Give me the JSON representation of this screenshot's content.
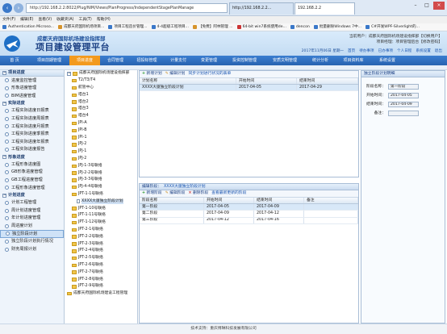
{
  "browser": {
    "url": "http://192.168.2.2:8022/Plug/NIM/Views/PlanProgress/IndependentStagePlanManage",
    "tabs": [
      "http://192.168.2.2...",
      "192.168.2.2"
    ],
    "menu": [
      "文件(F)",
      "编辑(E)",
      "查看(V)",
      "收藏夹(A)",
      "工具(T)",
      "帮助(H)"
    ],
    "favorites": [
      "Authentication Microso...",
      "成都天府国际机场项目...",
      "项目工程造价管理...",
      "4-4超级工程项目...",
      "【免费】阿林管理 ...",
      "64-bit win7系统使用de...",
      "dencon",
      "批量删除Windows 7中...",
      "C#开发WPF-Silverlight的..."
    ]
  },
  "header": {
    "system_name": "成都天府国际机场建设指挥部",
    "title": "项目建设管理平台",
    "user_line": "当前用户：成都天府国际机场建设指挥部【切换用户】",
    "user_line2": "项目经理：项目管理后台【修改密码】",
    "date": "2017年11月06日 星期一",
    "shortcuts": [
      "首页",
      "待办事项",
      "已办事项",
      "个人日程",
      "系统设置",
      "退出"
    ]
  },
  "nav": {
    "items": [
      "首 页",
      "项目前期管理",
      "项目进度",
      "合同管理",
      "招投标管理",
      "计量支付",
      "变更管理",
      "投资控制管理",
      "安质文明管理",
      "统计分析",
      "项目资料库",
      "系统设置"
    ],
    "active_index": 2
  },
  "sidebar": {
    "header": "项目进度",
    "groups": [
      {
        "label": "",
        "items": [
          "进度监控管理",
          "形象进度管理",
          "BIM进度管理"
        ]
      },
      {
        "label": "实际进度",
        "items": [
          "工程实际进度日报表",
          "工程实际进度周报表",
          "工程实际进度月报表",
          "工程实际进度季报表",
          "工程实际进度年报表",
          "工程实际进度报告"
        ]
      },
      {
        "label": "形象进度",
        "items": [
          "工程形象进度图",
          "GB形象进度管理",
          "GB工程进度管理",
          "工程形象进度管理"
        ]
      },
      {
        "label": "计划进度",
        "items": [
          "计划工程管理",
          "周计划进度管理",
          "年计划进度管理",
          "周进度计划"
        ]
      },
      {
        "label": "",
        "items": [
          "独立阶段计划",
          "独立阶段计划执行情况",
          "财务周报计划"
        ]
      }
    ],
    "active_item": "独立阶段计划"
  },
  "tree": {
    "root": "成都天府国际机场建设指挥部",
    "nodes": [
      "T2/T3/T4",
      "航管中心",
      "塔台1",
      "塔台2",
      "塔台3",
      "塔台4",
      "JPI-A",
      "JPI-B",
      "JPI-1",
      "JPJ-2",
      "JPJ-1",
      "JPJ-2",
      "JPJ-1-3号联络",
      "JPJ-2-2号联络",
      "JPJ-3-3号联络",
      "JPJ-4-4号联络",
      "JPT-1-1号联络",
      "JPT-1-10号联络",
      "JPT-1-11号联络",
      "JPT-1-12号联络",
      "JPT-2-1号联络",
      "JPT-2-2号联络",
      "JPT-2-3号联络",
      "JPT-2-4号联络",
      "JPT-2-5号联络",
      "JPT-2-6号联络",
      "JPT-2-7号联络",
      "JPT-2-8号联络",
      "JPT-2-9号联络",
      "成都天府国际机场建设工程管理"
    ],
    "selected_child": "XXXX大厦独立阶段计划"
  },
  "top_panel": {
    "toolbar": [
      "新增计划",
      "编辑计划",
      "同步计划进行状况的表单"
    ],
    "columns": [
      "计划名称",
      "开始时间",
      "结束时间"
    ],
    "rows": [
      [
        "XXXX大厦独立阶段计划",
        "2017-04-05",
        "2017-04-29"
      ]
    ]
  },
  "bottom_panel": {
    "title_prefix": "编辑阶段：",
    "title_plan": "XXXX大厦独立阶段计划",
    "toolbar": [
      "新增阶段",
      "编辑阶段",
      "删除阶段",
      "查看最新更新的阶段"
    ],
    "columns": [
      "阶段名称",
      "开始时间",
      "结束时间",
      "备注"
    ],
    "rows": [
      [
        "第一阶段",
        "2017-04-05",
        "2017-04-09",
        ""
      ],
      [
        "第二阶段",
        "2017-04-09",
        "2017-04-12",
        ""
      ],
      [
        "第三阶段",
        "2017-04-12",
        "2017-04-16",
        ""
      ]
    ]
  },
  "form": {
    "title": "独立阶段计划明细",
    "fields": [
      {
        "label": "阶段名称：",
        "value": "第一阶段"
      },
      {
        "label": "开始时间：",
        "value": "2017-04-05"
      },
      {
        "label": "结束时间：",
        "value": "2017-04-09"
      },
      {
        "label": "备注：",
        "value": ""
      }
    ]
  },
  "footer": "技术支持：重庆博琳科技发展有限公司",
  "colors": {
    "nav_bg": "#2b6cc0",
    "nav_active": "#f39a1e",
    "accent": "#1a55b0"
  }
}
